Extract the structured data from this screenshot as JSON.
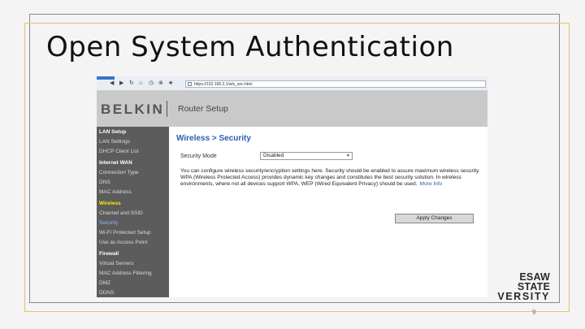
{
  "slide": {
    "title": "Open System Authentication",
    "page_number": "9",
    "logo": {
      "line1": "ESAW STATE",
      "line2": "VERSITY"
    }
  },
  "browser": {
    "url": "https://192.168.2.1/wls_sec.html",
    "nav_icons": [
      "back-icon",
      "forward-icon",
      "reload-icon",
      "home-icon",
      "history-icon",
      "stop-icon",
      "star-icon"
    ]
  },
  "router": {
    "brand": "BELKIN",
    "header_title": "Router Setup",
    "sidebar": [
      {
        "label": "LAN Setup",
        "type": "section"
      },
      {
        "label": "LAN Settings",
        "type": "item"
      },
      {
        "label": "DHCP Client List",
        "type": "item"
      },
      {
        "label": "Internet WAN",
        "type": "section"
      },
      {
        "label": "Connection Type",
        "type": "item"
      },
      {
        "label": "DNS",
        "type": "item"
      },
      {
        "label": "MAC Address",
        "type": "item"
      },
      {
        "label": "Wireless",
        "type": "active-section"
      },
      {
        "label": "Channel and SSID",
        "type": "item"
      },
      {
        "label": "Security",
        "type": "selected"
      },
      {
        "label": "Wi-Fi Protected Setup",
        "type": "item"
      },
      {
        "label": "Use as Access Point",
        "type": "item"
      },
      {
        "label": "Firewall",
        "type": "section"
      },
      {
        "label": "Virtual Servers",
        "type": "item"
      },
      {
        "label": "MAC Address Filtering",
        "type": "item"
      },
      {
        "label": "DMZ",
        "type": "item"
      },
      {
        "label": "DDNS",
        "type": "item"
      }
    ],
    "page_title": "Wireless > Security",
    "security_mode_label": "Security Mode",
    "security_mode_value": "Disabled",
    "description": "You can configure wireless security/encryption settings here. Security should be enabled to assure maximum wireless security. WPA (Wireless Protected Access) provides dynamic key changes and constitutes the best security solution. In wireless environments, where not all devices support WPA, WEP (Wired Equivalent Privacy) should be used.",
    "more_info": "More Info",
    "apply_button": "Apply Changes"
  },
  "colors": {
    "accent_gold": "#e2c566",
    "link_blue": "#2a5db0",
    "sidebar_bg": "#5c5c5c",
    "active_yellow": "#ffe800"
  }
}
